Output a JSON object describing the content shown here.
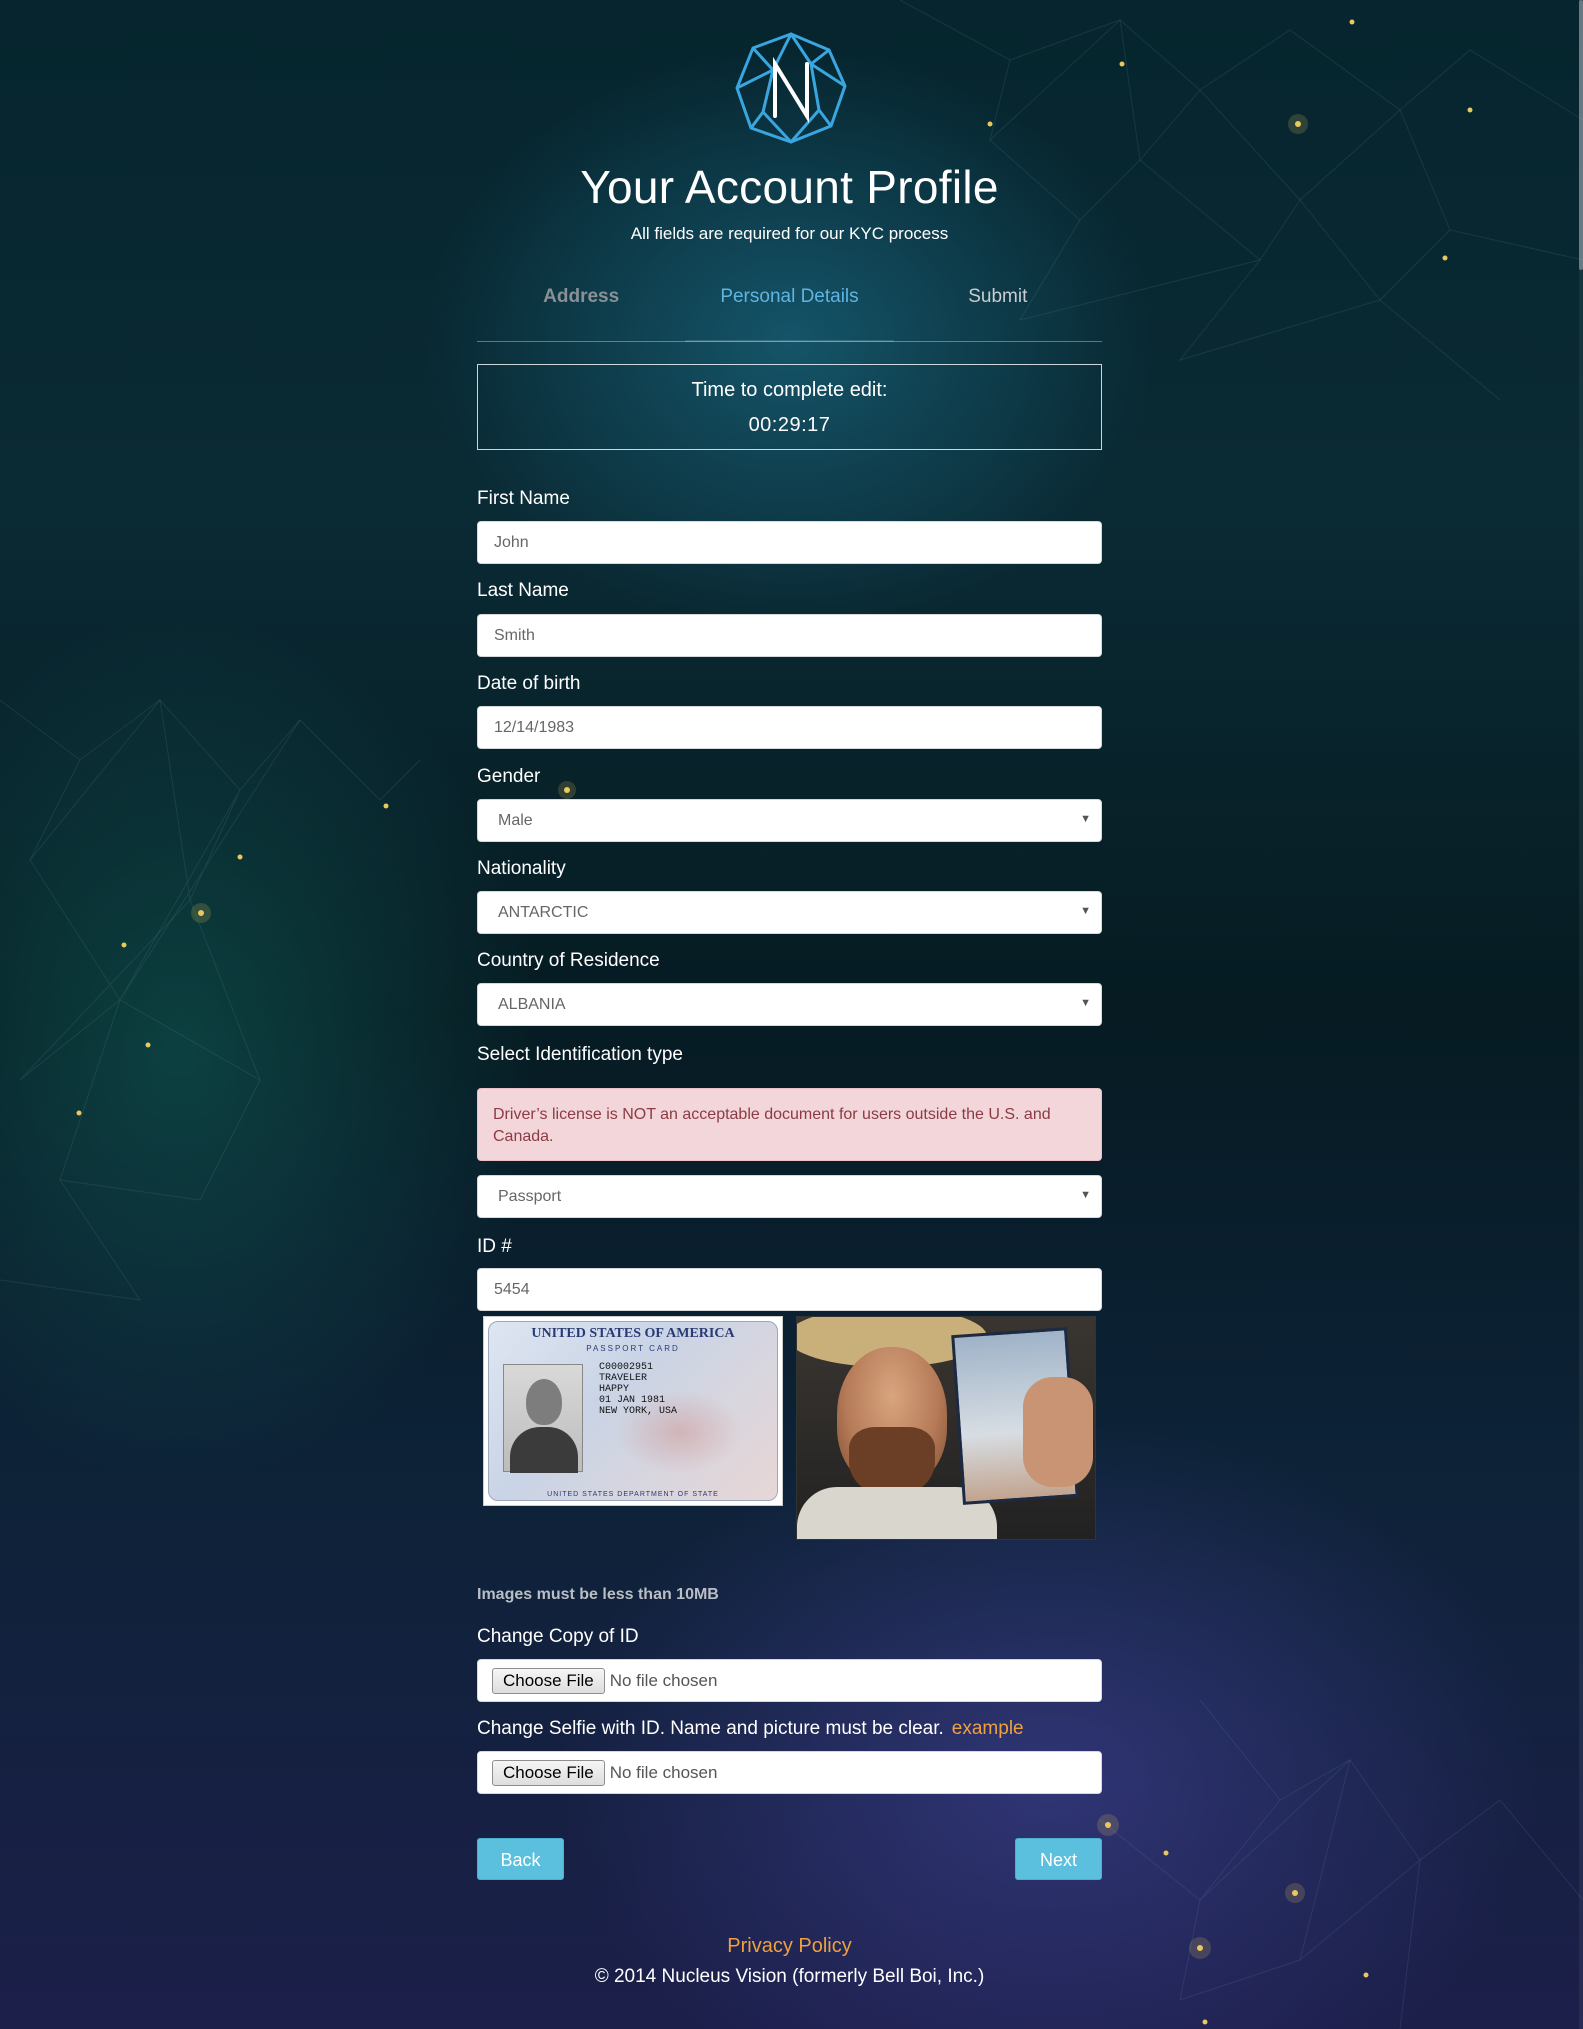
{
  "header": {
    "title": "Your Account Profile",
    "subtitle": "All fields are required for our KYC process"
  },
  "steps": [
    {
      "label": "Address",
      "state": "done"
    },
    {
      "label": "Personal Details",
      "state": "active"
    },
    {
      "label": "Submit",
      "state": "todo"
    }
  ],
  "timer": {
    "label": "Time to complete edit:",
    "value": "00:29:17"
  },
  "form": {
    "first_name": {
      "label": "First Name",
      "value": "John"
    },
    "last_name": {
      "label": "Last Name",
      "value": "Smith"
    },
    "dob": {
      "label": "Date of birth",
      "value": "12/14/1983"
    },
    "gender": {
      "label": "Gender",
      "value": "Male"
    },
    "nationality": {
      "label": "Nationality",
      "value": "ANTARCTIC"
    },
    "residence": {
      "label": "Country of Residence",
      "value": "ALBANIA"
    },
    "id_type": {
      "label": "Select Identification type",
      "warning": "Driver’s license is NOT an acceptable document for users outside the U.S. and Canada.",
      "value": "Passport"
    },
    "id_number": {
      "label": "ID #",
      "value": "5454"
    }
  },
  "id_card": {
    "heading": "UNITED STATES OF AMERICA",
    "subheading": "PASSPORT CARD",
    "card_no": "C00002951",
    "surname": "TRAVELER",
    "given": "HAPPY",
    "dob": "01 JAN 1981",
    "place": "NEW YORK, USA",
    "footer": "UNITED STATES DEPARTMENT OF STATE"
  },
  "uploads": {
    "note": "Images must be less than 10MB",
    "copy_label": "Change Copy of ID",
    "selfie_label": "Change Selfie with ID. Name and picture must be clear.",
    "example_link": "example",
    "choose_btn": "Choose File",
    "no_file": "No file chosen"
  },
  "nav": {
    "back": "Back",
    "next": "Next"
  },
  "footer": {
    "privacy": "Privacy Policy",
    "copyright": "© 2014 Nucleus Vision (formerly Bell Boi, Inc.)"
  },
  "colors": {
    "accent": "#5bc0de",
    "active_step": "#5fb4e0",
    "link": "#f0a040",
    "alert_bg": "#f3d6da",
    "alert_text": "#8b3b44"
  }
}
